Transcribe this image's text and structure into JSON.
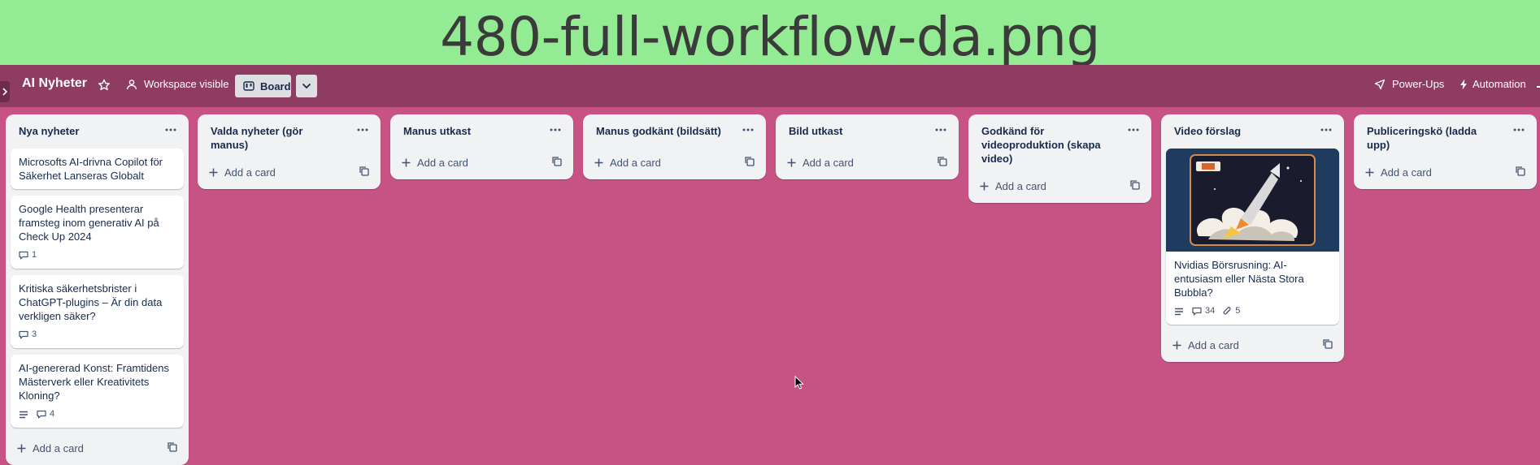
{
  "banner": {
    "title": "480-full-workflow-da.png"
  },
  "header": {
    "board_title": "AI Nyheter",
    "visibility_label": "Workspace visible",
    "view_label": "Board",
    "powerups_label": "Power-Ups",
    "automation_label": "Automation"
  },
  "add_card_label": "Add a card",
  "lists": [
    {
      "title": "Nya nyheter",
      "cards": [
        {
          "title": "Microsofts AI-drivna Copilot för Säkerhet Lanseras Globalt"
        },
        {
          "title": "Google Health presenterar framsteg inom generativ AI på Check Up 2024",
          "comments": "1"
        },
        {
          "title": "Kritiska säkerhetsbrister i ChatGPT-plugins – Är din data verkligen säker?",
          "comments": "3"
        },
        {
          "title": "AI-genererad Konst: Framtidens Mästerverk eller Kreativitets Kloning?",
          "comments": "4"
        }
      ]
    },
    {
      "title": "Valda nyheter (gör manus)"
    },
    {
      "title": "Manus utkast"
    },
    {
      "title": "Manus godkänt (bildsätt)"
    },
    {
      "title": "Bild utkast"
    },
    {
      "title": "Godkänd för videoproduktion (skapa video)"
    },
    {
      "title": "Video förslag",
      "cards": [
        {
          "title": "Nvidias Börsrusning: AI-entusiasm eller Nästa Stora Bubbla?",
          "comments": "34",
          "attachments": "5"
        }
      ]
    },
    {
      "title": "Publiceringskö (ladda upp)"
    }
  ],
  "colors": {
    "banner": "#93ec93",
    "board_background": "#c65384",
    "header_bar": "#8f3c63",
    "list_background": "#f1f2f4",
    "text": "#172b4d"
  },
  "icons": {
    "star": "star-icon",
    "visibility": "people-icon",
    "board": "board-icon",
    "dropdown": "chevron-down-icon",
    "powerups": "rocket-icon",
    "automation": "lightning-icon",
    "comment": "comment-icon",
    "description": "description-icon",
    "attachment": "paperclip-icon",
    "template": "card-template-icon"
  }
}
